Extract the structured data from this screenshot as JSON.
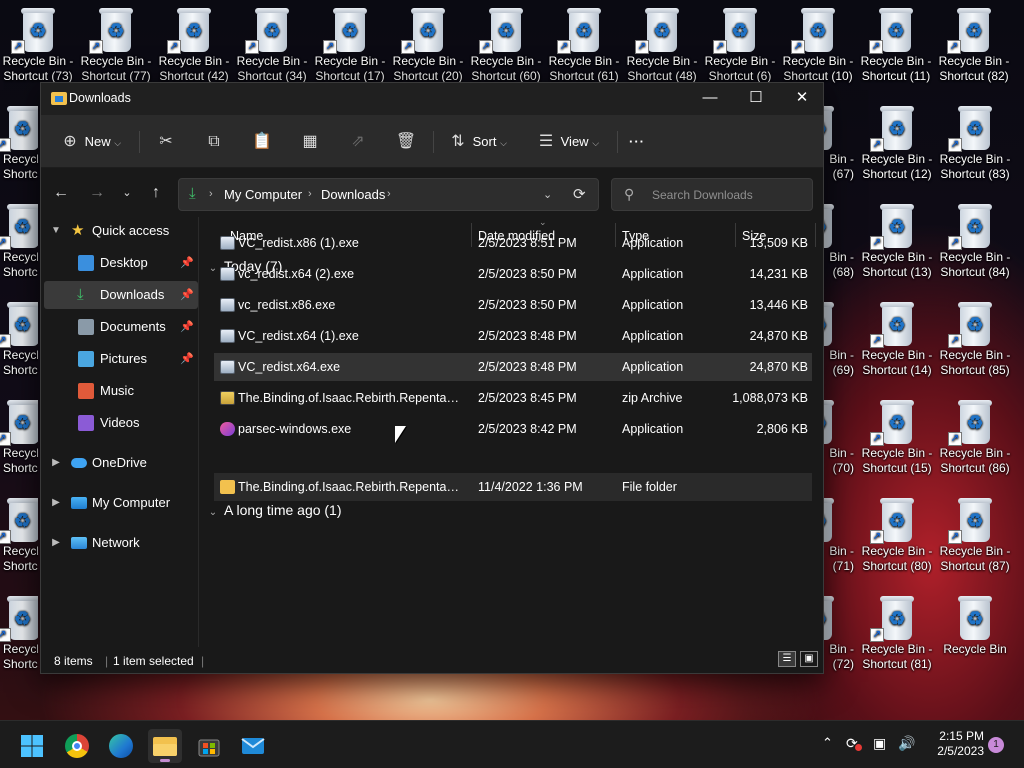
{
  "desktop": {
    "icons_top_row": [
      {
        "line1": "Recycle Bin -",
        "line2": "Shortcut (73)"
      },
      {
        "line1": "Recycle Bin -",
        "line2": "Shortcut (77)"
      },
      {
        "line1": "Recycle Bin -",
        "line2": "Shortcut (42)"
      },
      {
        "line1": "Recycle Bin -",
        "line2": "Shortcut (34)"
      },
      {
        "line1": "Recycle Bin -",
        "line2": "Shortcut (17)"
      },
      {
        "line1": "Recycle Bin -",
        "line2": "Shortcut (20)"
      },
      {
        "line1": "Recycle Bin -",
        "line2": "Shortcut (60)"
      },
      {
        "line1": "Recycle Bin -",
        "line2": "Shortcut (61)"
      },
      {
        "line1": "Recycle Bin -",
        "line2": "Shortcut (48)"
      },
      {
        "line1": "Recycle Bin -",
        "line2": "Shortcut (6)"
      },
      {
        "line1": "Recycle Bin -",
        "line2": "Shortcut (10)"
      },
      {
        "line1": "Recycle Bin -",
        "line2": "Shortcut (11)"
      },
      {
        "line1": "Recycle Bin -",
        "line2": "Shortcut (82)"
      }
    ],
    "icons_col_a": [
      {
        "line1": "Bin -",
        "line2": "(67)"
      },
      {
        "line1": "Bin -",
        "line2": "(68)"
      },
      {
        "line1": "Bin -",
        "line2": "(69)"
      },
      {
        "line1": "Bin -",
        "line2": "(70)"
      },
      {
        "line1": "Bin -",
        "line2": "(71)"
      },
      {
        "line1": "Bin -",
        "line2": "(72)"
      }
    ],
    "icons_col_b": [
      {
        "line1": "Recycle Bin -",
        "line2": "Shortcut (12)"
      },
      {
        "line1": "Recycle Bin -",
        "line2": "Shortcut (13)"
      },
      {
        "line1": "Recycle Bin -",
        "line2": "Shortcut (14)"
      },
      {
        "line1": "Recycle Bin -",
        "line2": "Shortcut (15)"
      },
      {
        "line1": "Recycle Bin -",
        "line2": "Shortcut (80)"
      },
      {
        "line1": "Recycle Bin -",
        "line2": "Shortcut (81)"
      }
    ],
    "icons_col_c": [
      {
        "line1": "Recycle Bin -",
        "line2": "Shortcut (83)"
      },
      {
        "line1": "Recycle Bin -",
        "line2": "Shortcut (84)"
      },
      {
        "line1": "Recycle Bin -",
        "line2": "Shortcut (85)"
      },
      {
        "line1": "Recycle Bin -",
        "line2": "Shortcut (86)"
      },
      {
        "line1": "Recycle Bin -",
        "line2": "Shortcut (87)"
      },
      {
        "line1": "Recycle Bin",
        "line2": ""
      }
    ],
    "icons_left": [
      {
        "line1": "Recycle",
        "line2": "Shortc"
      },
      {
        "line1": "Recycle",
        "line2": "Shortc"
      },
      {
        "line1": "Recycle",
        "line2": "Shortc"
      },
      {
        "line1": "Recycle",
        "line2": "Shortc"
      },
      {
        "line1": "Recycle",
        "line2": "Shortc"
      },
      {
        "line1": "Recycle",
        "line2": "Shortc"
      }
    ]
  },
  "window": {
    "title": "Downloads",
    "toolbar": {
      "new_label": "New",
      "sort_label": "Sort",
      "view_label": "View"
    },
    "address": {
      "segment1": "My Computer",
      "segment2": "Downloads"
    },
    "search": {
      "placeholder": "Search Downloads"
    },
    "sidebar": {
      "quick_access": "Quick access",
      "items": [
        "Desktop",
        "Downloads",
        "Documents",
        "Pictures",
        "Music",
        "Videos"
      ],
      "onedrive": "OneDrive",
      "my_computer": "My Computer",
      "network": "Network"
    },
    "columns": {
      "name": "Name",
      "date": "Date modified",
      "type": "Type",
      "size": "Size"
    },
    "groups": {
      "today": "Today (7)",
      "long_ago": "A long time ago (1)"
    },
    "files": [
      {
        "name": "VC_redist.x86 (1).exe",
        "date": "2/5/2023 8:51 PM",
        "type": "Application",
        "size": "13,509 KB"
      },
      {
        "name": "vc_redist.x64 (2).exe",
        "date": "2/5/2023 8:50 PM",
        "type": "Application",
        "size": "14,231 KB"
      },
      {
        "name": "vc_redist.x86.exe",
        "date": "2/5/2023 8:50 PM",
        "type": "Application",
        "size": "13,446 KB"
      },
      {
        "name": "VC_redist.x64 (1).exe",
        "date": "2/5/2023 8:48 PM",
        "type": "Application",
        "size": "24,870 KB"
      },
      {
        "name": "VC_redist.x64.exe",
        "date": "2/5/2023 8:48 PM",
        "type": "Application",
        "size": "24,870 KB"
      },
      {
        "name": "The.Binding.of.Isaac.Rebirth.Repentance....",
        "date": "2/5/2023 8:45 PM",
        "type": "zip Archive",
        "size": "1,088,073 KB"
      },
      {
        "name": "parsec-windows.exe",
        "date": "2/5/2023 8:42 PM",
        "type": "Application",
        "size": "2,806 KB"
      }
    ],
    "old_files": [
      {
        "name": "The.Binding.of.Isaac.Rebirth.Repentance....",
        "date": "11/4/2022 1:36 PM",
        "type": "File folder",
        "size": ""
      }
    ],
    "status": {
      "count": "8 items",
      "selected": "1 item selected"
    }
  },
  "taskbar": {
    "time": "2:15 PM",
    "date": "2/5/2023",
    "notifications": "1"
  }
}
